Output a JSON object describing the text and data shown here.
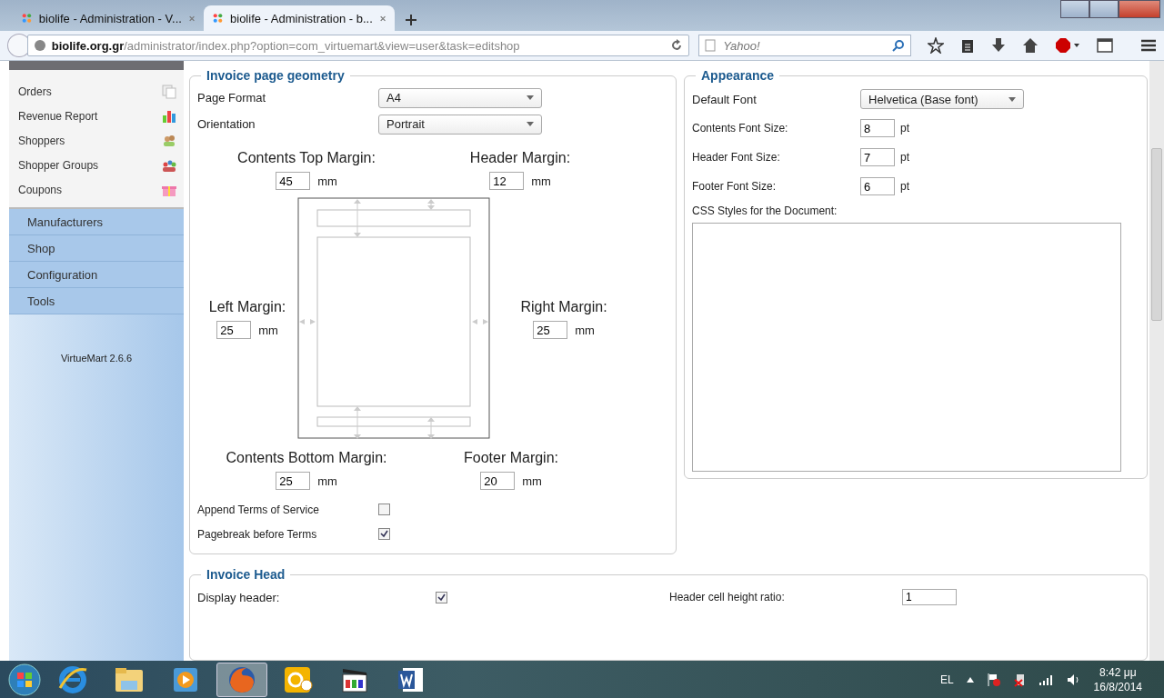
{
  "browser": {
    "tabs": [
      {
        "title": "biolife - Administration - V...",
        "selected": false
      },
      {
        "title": "biolife - Administration - b...",
        "selected": true
      }
    ],
    "url": {
      "host": "biolife.org.gr",
      "path": "/administrator/index.php?option=com_virtuemart&view=user&task=editshop"
    },
    "search": {
      "placeholder": "Yahoo!"
    }
  },
  "sidebar": {
    "items": [
      {
        "label": "Orders"
      },
      {
        "label": "Revenue Report"
      },
      {
        "label": "Shoppers"
      },
      {
        "label": "Shopper Groups"
      },
      {
        "label": "Coupons"
      }
    ],
    "menus": [
      {
        "label": "Manufacturers"
      },
      {
        "label": "Shop"
      },
      {
        "label": "Configuration"
      },
      {
        "label": "Tools"
      }
    ],
    "version": "VirtueMart 2.6.6"
  },
  "geometry": {
    "title": "Invoice page geometry",
    "selects": [
      {
        "label": "Page Format",
        "value": "A4"
      },
      {
        "label": "Orientation",
        "value": "Portrait"
      }
    ],
    "margins": {
      "top": {
        "label": "Contents Top Margin:",
        "value": "45",
        "unit": "mm"
      },
      "header": {
        "label": "Header Margin:",
        "value": "12",
        "unit": "mm"
      },
      "left": {
        "label": "Left Margin:",
        "value": "25",
        "unit": "mm"
      },
      "right": {
        "label": "Right Margin:",
        "value": "25",
        "unit": "mm"
      },
      "bottom": {
        "label": "Contents Bottom Margin:",
        "value": "25",
        "unit": "mm"
      },
      "footer": {
        "label": "Footer Margin:",
        "value": "20",
        "unit": "mm"
      }
    },
    "checkboxes": [
      {
        "label": "Append Terms of Service",
        "checked": false
      },
      {
        "label": "Pagebreak before Terms",
        "checked": true
      }
    ]
  },
  "appearance": {
    "title": "Appearance",
    "default_font": {
      "label": "Default Font",
      "value": "Helvetica (Base font)"
    },
    "sizes": [
      {
        "label": "Contents Font Size:",
        "value": "8",
        "unit": "pt"
      },
      {
        "label": "Header Font Size:",
        "value": "7",
        "unit": "pt"
      },
      {
        "label": "Footer Font Size:",
        "value": "6",
        "unit": "pt"
      }
    ],
    "css_label": "CSS Styles for the Document:"
  },
  "invoice_head": {
    "title": "Invoice Head",
    "display_header": {
      "label": "Display header:",
      "checked": true
    },
    "ratio": {
      "label": "Header cell height ratio:",
      "value": "1"
    }
  },
  "taskbar": {
    "apps": [
      {
        "kind": "ie",
        "selected": false
      },
      {
        "kind": "explorer",
        "selected": false
      },
      {
        "kind": "media",
        "selected": false
      },
      {
        "kind": "firefox",
        "selected": true
      },
      {
        "kind": "outlook",
        "selected": false
      },
      {
        "kind": "clapper",
        "selected": false
      },
      {
        "kind": "word",
        "selected": false
      }
    ],
    "language": "EL",
    "time": "8:42 μμ",
    "date": "16/8/2014"
  }
}
